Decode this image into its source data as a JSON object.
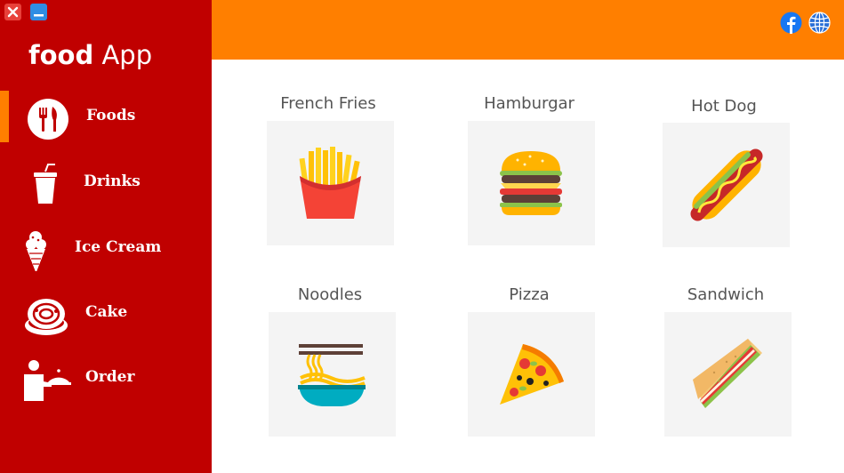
{
  "window": {
    "close_icon": "close-icon",
    "minimize_icon": "minimize-icon"
  },
  "app": {
    "title_bold": "food",
    "title_rest": "App"
  },
  "sidebar": {
    "accent": "#c00000",
    "active_indicator": "#ff7f00",
    "items": [
      {
        "label": "Foods",
        "icon": "fork-knife-icon",
        "active": true
      },
      {
        "label": "Drinks",
        "icon": "drink-cup-icon",
        "active": false
      },
      {
        "label": "Ice Cream",
        "icon": "ice-cream-icon",
        "active": false
      },
      {
        "label": "Cake",
        "icon": "cake-icon",
        "active": false
      },
      {
        "label": "Order",
        "icon": "waiter-icon",
        "active": false
      }
    ]
  },
  "topbar": {
    "color": "#ff7f00",
    "icons": [
      "facebook-icon",
      "globe-icon"
    ]
  },
  "foods": [
    {
      "name": "French Fries",
      "icon": "french-fries-icon"
    },
    {
      "name": "Hamburgar",
      "icon": "hamburger-icon"
    },
    {
      "name": "Hot Dog",
      "icon": "hot-dog-icon"
    },
    {
      "name": "Noodles",
      "icon": "noodles-icon"
    },
    {
      "name": "Pizza",
      "icon": "pizza-icon"
    },
    {
      "name": "Sandwich",
      "icon": "sandwich-icon"
    }
  ]
}
